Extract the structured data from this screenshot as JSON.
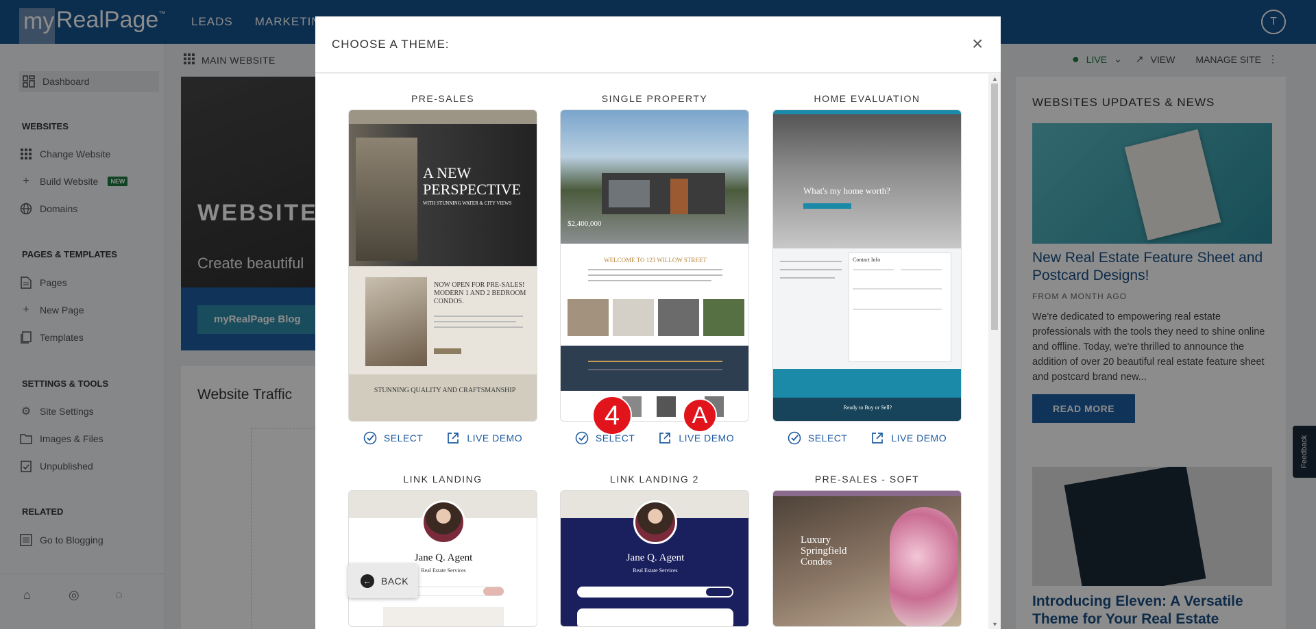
{
  "brand": {
    "logo_my": "my",
    "logo_rest": "RealPage",
    "logo_tm": "™"
  },
  "topnav": {
    "items": [
      "LEADS",
      "MARKETIN"
    ],
    "user_initial": "T"
  },
  "subheader": {
    "left": "MAIN WEBSITE",
    "status": "LIVE",
    "view": "VIEW",
    "manage": "MANAGE SITE"
  },
  "sidebar": {
    "dashboard": "Dashboard",
    "sections": [
      {
        "title": "WEBSITES",
        "items": [
          "Change Website",
          "Build Website",
          "Domains"
        ]
      },
      {
        "title": "PAGES & TEMPLATES",
        "items": [
          "Pages",
          "New Page",
          "Templates"
        ]
      },
      {
        "title": "SETTINGS & TOOLS",
        "items": [
          "Site Settings",
          "Images & Files",
          "Unpublished"
        ]
      },
      {
        "title": "RELATED",
        "items": [
          "Go to Blogging"
        ]
      }
    ],
    "new_badge": "NEW"
  },
  "hero": {
    "title": "WEBSITES",
    "subtitle": "Create beautiful",
    "button": "myRealPage Blog"
  },
  "traffic": {
    "title": "Website Traffic"
  },
  "news": {
    "heading": "WEBSITES UPDATES & NEWS",
    "article1": {
      "title": "New Real Estate Feature Sheet and Postcard Designs!",
      "meta": "FROM A MONTH AGO",
      "body": "We're dedicated to empowering real estate professionals with the tools they need to shine online and offline. Today, we're thrilled to announce the addition of over 20 beautiful real estate feature sheet and postcard brand new...",
      "button": "READ MORE"
    },
    "article2": {
      "title": "Introducing Eleven: A Versatile Theme for Your Real Estate"
    }
  },
  "feedback": "Feedback",
  "modal": {
    "title": "CHOOSE A THEME:",
    "select_label": "SELECT",
    "demo_label": "LIVE DEMO",
    "back_label": "BACK",
    "themes": [
      {
        "name": "PRE-SALES"
      },
      {
        "name": "SINGLE PROPERTY"
      },
      {
        "name": "HOME EVALUATION"
      },
      {
        "name": "LINK LANDING"
      },
      {
        "name": "LINK LANDING 2"
      },
      {
        "name": "PRE-SALES - SOFT"
      }
    ],
    "thumb_text": {
      "presales_headline": "A NEW PERSPECTIVE",
      "presales_sub": "WITH STUNNING WATER & CITY VIEWS",
      "presales_open": "NOW OPEN FOR PRE-SALES! MODERN 1 AND 2 BEDROOM CONDOS.",
      "presales_footer": "STUNNING QUALITY AND CRAFTSMANSHIP",
      "single_welcome": "WELCOME TO 123 WILLOW STREET",
      "single_price": "$2,400,000",
      "home_eval_q": "What's my home worth?",
      "home_eval_form": "Contact Info",
      "home_eval_bottom": "Ready to Buy or Sell?",
      "agent_name": "Jane Q. Agent",
      "agent_sub": "Real Estate Services",
      "condos": "Luxury Springfield Condos"
    }
  },
  "markers": [
    "4",
    "A"
  ]
}
